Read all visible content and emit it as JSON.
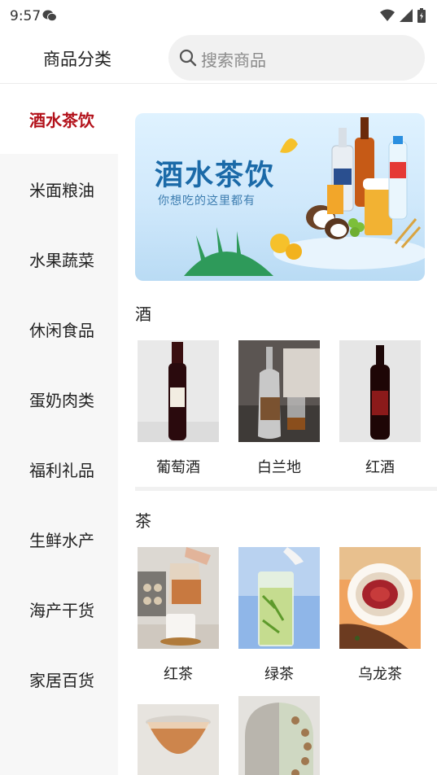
{
  "status_bar": {
    "time": "9:57"
  },
  "header": {
    "title": "商品分类"
  },
  "search": {
    "placeholder": "搜索商品"
  },
  "sidebar": {
    "items": [
      {
        "label": "酒水茶饮",
        "active": true
      },
      {
        "label": "米面粮油"
      },
      {
        "label": "水果蔬菜"
      },
      {
        "label": "休闲食品"
      },
      {
        "label": "蛋奶肉类"
      },
      {
        "label": "福利礼品"
      },
      {
        "label": "生鲜水产"
      },
      {
        "label": "海产干货"
      },
      {
        "label": "家居百货"
      }
    ]
  },
  "banner": {
    "title": "酒水茶饮",
    "subtitle": "你想吃的这里都有"
  },
  "sections": [
    {
      "title": "酒",
      "products": [
        {
          "name": "葡萄酒"
        },
        {
          "name": "白兰地"
        },
        {
          "name": "红酒"
        }
      ]
    },
    {
      "title": "茶",
      "products": [
        {
          "name": "红茶"
        },
        {
          "name": "绿茶"
        },
        {
          "name": "乌龙茶"
        },
        {
          "name": ""
        },
        {
          "name": ""
        }
      ]
    }
  ],
  "colors": {
    "accent": "#b3121b",
    "sidebar_bg": "#f7f7f7",
    "search_bg": "#f1f1f1"
  }
}
